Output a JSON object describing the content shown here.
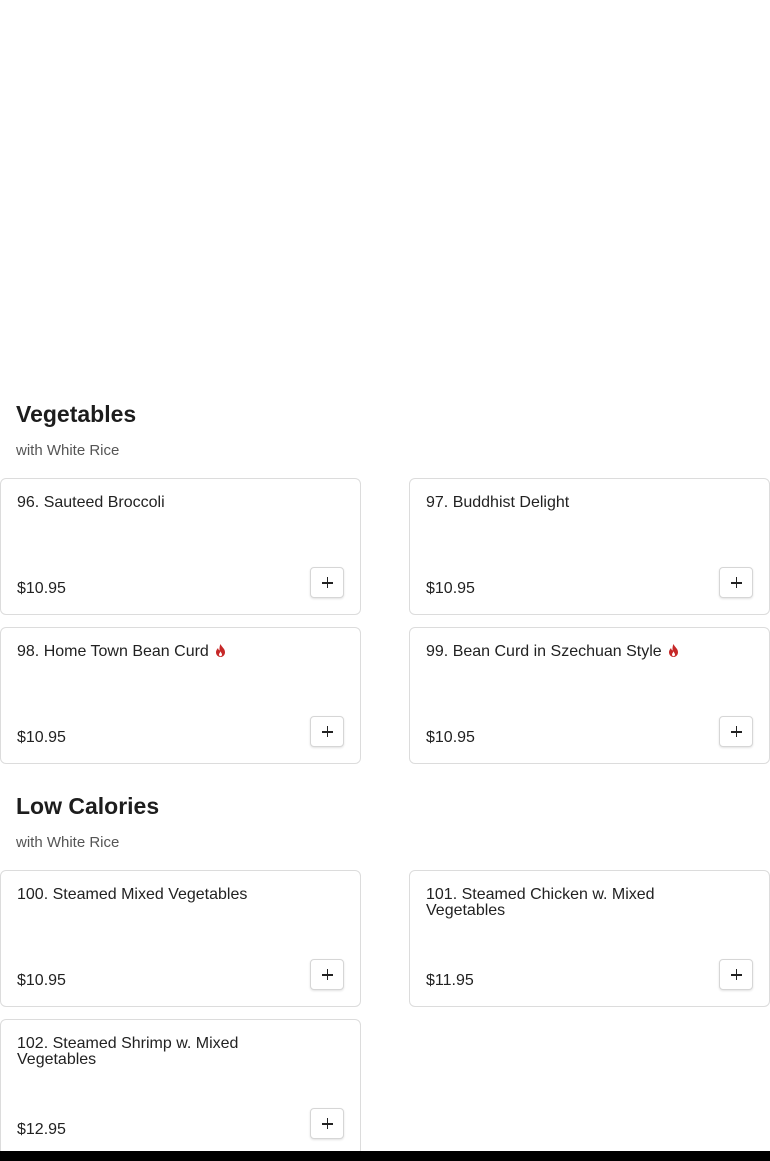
{
  "sections": [
    {
      "title": "Vegetables",
      "subtitle": "with White Rice",
      "items": [
        {
          "name": "96. Sauteed Broccoli",
          "price": "$10.95",
          "spicy": false
        },
        {
          "name": "97. Buddhist Delight",
          "price": "$10.95",
          "spicy": false
        },
        {
          "name": "98. Home Town Bean Curd",
          "price": "$10.95",
          "spicy": true
        },
        {
          "name": "99. Bean Curd in Szechuan Style",
          "price": "$10.95",
          "spicy": true
        }
      ]
    },
    {
      "title": "Low Calories",
      "subtitle": "with White Rice",
      "items": [
        {
          "name": "100. Steamed Mixed Vegetables",
          "price": "$10.95",
          "spicy": false
        },
        {
          "name": "101. Steamed Chicken w. Mixed Vegetables",
          "price": "$11.95",
          "spicy": false
        },
        {
          "name": "102. Steamed Shrimp w. Mixed Vegetables",
          "price": "$12.95",
          "spicy": false
        }
      ]
    }
  ],
  "icons": {
    "add": "plus-icon",
    "spicy": "flame-icon"
  },
  "colors": {
    "spicy": "#c62828",
    "card_border": "#dcdcdc"
  }
}
